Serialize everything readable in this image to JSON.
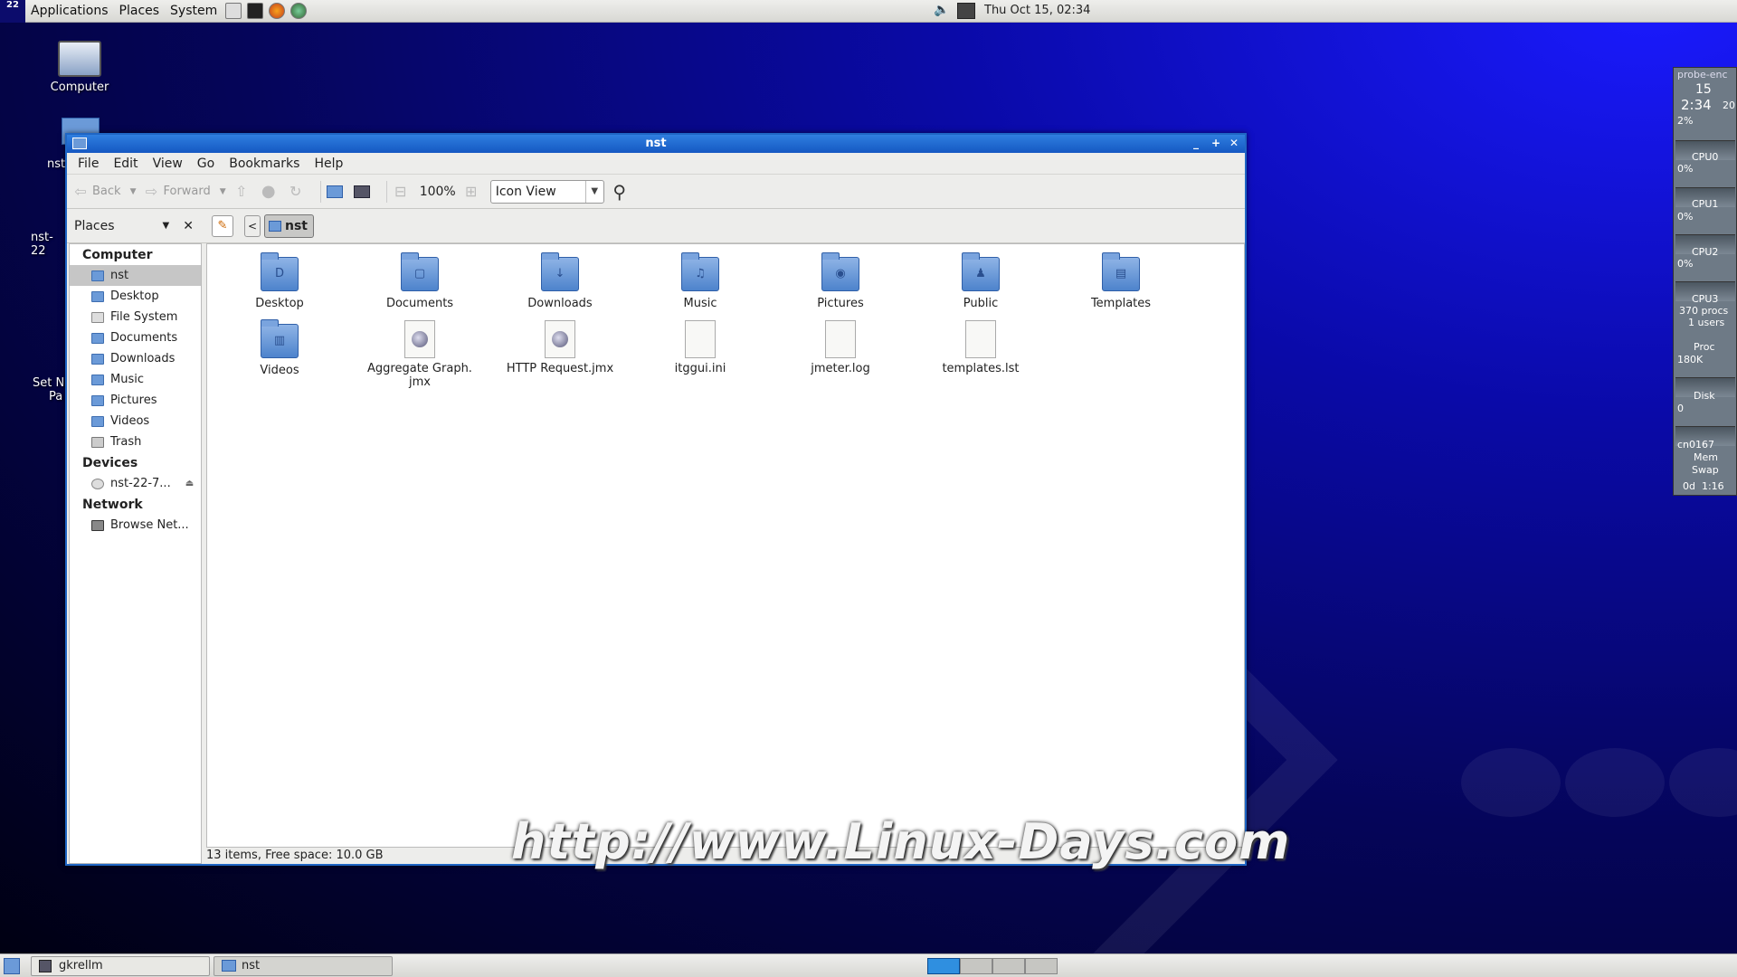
{
  "top_panel": {
    "distro_badge": "22",
    "menus": [
      "Applications",
      "Places",
      "System"
    ],
    "clock": "Thu Oct 15, 02:34"
  },
  "desktop_icons": {
    "computer": "Computer",
    "nst_home": "nst",
    "nst_disc": "nst-22",
    "set_pass": "Set N",
    "set_pass2": "Pa"
  },
  "window": {
    "title": "nst",
    "menus": [
      "File",
      "Edit",
      "View",
      "Go",
      "Bookmarks",
      "Help"
    ],
    "toolbar": {
      "back": "Back",
      "forward": "Forward",
      "zoom": "100%",
      "view_mode": "Icon View"
    },
    "location": {
      "places_label": "Places",
      "current": "nst"
    },
    "sidebar": {
      "groups": [
        {
          "title": "Computer",
          "items": [
            "nst",
            "Desktop",
            "File System",
            "Documents",
            "Downloads",
            "Music",
            "Pictures",
            "Videos",
            "Trash"
          ]
        },
        {
          "title": "Devices",
          "items": [
            "nst-22-7..."
          ]
        },
        {
          "title": "Network",
          "items": [
            "Browse Net..."
          ]
        }
      ]
    },
    "files": [
      {
        "name": "Desktop",
        "type": "folder",
        "glyph": "D"
      },
      {
        "name": "Documents",
        "type": "folder",
        "glyph": "▢"
      },
      {
        "name": "Downloads",
        "type": "folder",
        "glyph": "↓"
      },
      {
        "name": "Music",
        "type": "folder",
        "glyph": "♫"
      },
      {
        "name": "Pictures",
        "type": "folder",
        "glyph": "◉"
      },
      {
        "name": "Public",
        "type": "folder",
        "glyph": "♟"
      },
      {
        "name": "Templates",
        "type": "folder",
        "glyph": "▤"
      },
      {
        "name": "Videos",
        "type": "folder",
        "glyph": "▥"
      },
      {
        "name": "Aggregate Graph.\njmx",
        "type": "web"
      },
      {
        "name": "HTTP Request.jmx",
        "type": "web"
      },
      {
        "name": "itggui.ini",
        "type": "doc"
      },
      {
        "name": "jmeter.log",
        "type": "doc"
      },
      {
        "name": "templates.lst",
        "type": "doc"
      }
    ],
    "status": "13 items, Free space: 10.0 GB"
  },
  "watermark": "http://www.Linux-Days.com",
  "gkrellm": {
    "host": "probe-enc",
    "date": "15",
    "time": "2:34",
    "sec": "20",
    "cpu_total": "2%",
    "cpu0": "CPU0",
    "cpu0_val": "0%",
    "cpu1": "CPU1",
    "cpu1_val": "0%",
    "cpu2": "CPU2",
    "cpu2_val": "0%",
    "cpu3": "CPU3",
    "procs": "370 procs",
    "users": "1 users",
    "proc": "Proc",
    "proc_val": "180K",
    "disk": "Disk",
    "disk_val": "0",
    "mem_label": "Mem",
    "swap_label": "Swap",
    "mem_val": "cn0167",
    "uptime": "0d  1:16"
  },
  "bottom_panel": {
    "tasks": [
      "gkrellm",
      "nst"
    ]
  }
}
